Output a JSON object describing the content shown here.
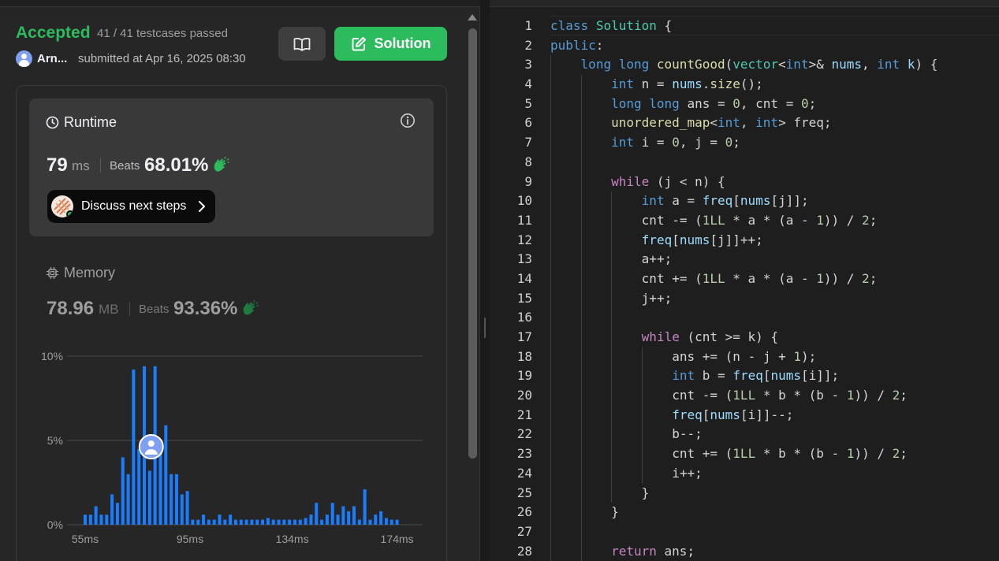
{
  "result": {
    "status": "Accepted",
    "testcases": "41 / 41 testcases passed",
    "username": "Arn...",
    "submitted": "submitted at Apr 16, 2025 08:30",
    "solution_button": "Solution"
  },
  "runtime": {
    "title": "Runtime",
    "value": "79",
    "unit": "ms",
    "beats_label": "Beats",
    "beats": "68.01%",
    "discuss_label": "Discuss next steps"
  },
  "memory": {
    "title": "Memory",
    "value": "78.96",
    "unit": "MB",
    "beats_label": "Beats",
    "beats": "93.36%"
  },
  "colors": {
    "accent_green": "#2cbb5d",
    "bar_blue": "#1a7dff"
  },
  "chart_data": {
    "type": "bar",
    "yticks": [
      "10%",
      "5%",
      "0%"
    ],
    "xticks": [
      "55ms",
      "95ms",
      "134ms",
      "174ms"
    ],
    "ylim": [
      0,
      10
    ],
    "xrange": [
      55,
      174
    ],
    "user_marker_x": 79,
    "series": [
      {
        "values": [
          0.6,
          0.6,
          1.1,
          0.6,
          0.6,
          1.8,
          1.3,
          4.0,
          3.0,
          9.2,
          4.5,
          9.4,
          3.2,
          9.4,
          4.5,
          5.9,
          3.0,
          3.0,
          1.8,
          2.0,
          0.3,
          0.3,
          0.6,
          0.3,
          0.3,
          0.6,
          0.3,
          0.6,
          0.3,
          0.3,
          0.3,
          0.3,
          0.3,
          0.3,
          0.4,
          0.3,
          0.3,
          0.3,
          0.3,
          0.3,
          0.3,
          0.4,
          0.6,
          1.3,
          0.3,
          0.6,
          1.3,
          0.6,
          1.1,
          0.8,
          1.1,
          0.3,
          2.1,
          0.3,
          0.6,
          0.8,
          0.4,
          0.3,
          0.3
        ]
      }
    ]
  },
  "editor": {
    "lines": [
      {
        "n": "1",
        "indent": 0,
        "html": "<span class=\"kw\">class</span> <span class=\"ty\">Solution</span> {"
      },
      {
        "n": "2",
        "indent": 0,
        "html": "<span class=\"kw\">public</span>:"
      },
      {
        "n": "3",
        "indent": 1,
        "html": "<span class=\"kw\">long</span> <span class=\"kw\">long</span> <span class=\"fn\">countGood</span>(<span class=\"ty\">vector</span>&lt;<span class=\"kw\">int</span>&gt;&amp; <span class=\"vr\">nums</span>, <span class=\"kw\">int</span> <span class=\"vr\">k</span>) {"
      },
      {
        "n": "4",
        "indent": 2,
        "html": "<span class=\"kw\">int</span> n = <span class=\"vr\">nums</span>.<span class=\"fn\">size</span>();"
      },
      {
        "n": "5",
        "indent": 2,
        "html": "<span class=\"kw\">long</span> <span class=\"kw\">long</span> ans = <span class=\"num\">0</span>, cnt = <span class=\"num\">0</span>;"
      },
      {
        "n": "6",
        "indent": 2,
        "html": "<span class=\"fn\">unordered_map</span>&lt;<span class=\"kw\">int</span>, <span class=\"kw\">int</span>&gt; freq;"
      },
      {
        "n": "7",
        "indent": 2,
        "html": "<span class=\"kw\">int</span> i = <span class=\"num\">0</span>, j = <span class=\"num\">0</span>;"
      },
      {
        "n": "8",
        "indent": 2,
        "html": ""
      },
      {
        "n": "9",
        "indent": 2,
        "html": "<span class=\"kw2\">while</span> (j &lt; n) {"
      },
      {
        "n": "10",
        "indent": 3,
        "html": "<span class=\"kw\">int</span> a = <span class=\"vr\">freq</span>[<span class=\"vr\">nums</span>[j]];"
      },
      {
        "n": "11",
        "indent": 3,
        "html": "cnt -= (<span class=\"num\">1LL</span> * a * (a - <span class=\"num\">1</span>)) / <span class=\"num\">2</span>;"
      },
      {
        "n": "12",
        "indent": 3,
        "html": "<span class=\"vr\">freq</span>[<span class=\"vr\">nums</span>[j]]++;"
      },
      {
        "n": "13",
        "indent": 3,
        "html": "a++;"
      },
      {
        "n": "14",
        "indent": 3,
        "html": "cnt += (<span class=\"num\">1LL</span> * a * (a - <span class=\"num\">1</span>)) / <span class=\"num\">2</span>;"
      },
      {
        "n": "15",
        "indent": 3,
        "html": "j++;"
      },
      {
        "n": "16",
        "indent": 3,
        "html": ""
      },
      {
        "n": "17",
        "indent": 3,
        "html": "<span class=\"kw2\">while</span> (cnt &gt;= k) {"
      },
      {
        "n": "18",
        "indent": 4,
        "html": "ans += (n - j + <span class=\"num\">1</span>);"
      },
      {
        "n": "19",
        "indent": 4,
        "html": "<span class=\"kw\">int</span> b = <span class=\"vr\">freq</span>[<span class=\"vr\">nums</span>[i]];"
      },
      {
        "n": "20",
        "indent": 4,
        "html": "cnt -= (<span class=\"num\">1LL</span> * b * (b - <span class=\"num\">1</span>)) / <span class=\"num\">2</span>;"
      },
      {
        "n": "21",
        "indent": 4,
        "html": "<span class=\"vr\">freq</span>[<span class=\"vr\">nums</span>[i]]--;"
      },
      {
        "n": "22",
        "indent": 4,
        "html": "b--;"
      },
      {
        "n": "23",
        "indent": 4,
        "html": "cnt += (<span class=\"num\">1LL</span> * b * (b - <span class=\"num\">1</span>)) / <span class=\"num\">2</span>;"
      },
      {
        "n": "24",
        "indent": 4,
        "html": "i++;"
      },
      {
        "n": "25",
        "indent": 3,
        "html": "}"
      },
      {
        "n": "26",
        "indent": 2,
        "html": "}"
      },
      {
        "n": "27",
        "indent": 2,
        "html": ""
      },
      {
        "n": "28",
        "indent": 2,
        "html": "<span class=\"kw2\">return</span> ans;"
      }
    ]
  }
}
